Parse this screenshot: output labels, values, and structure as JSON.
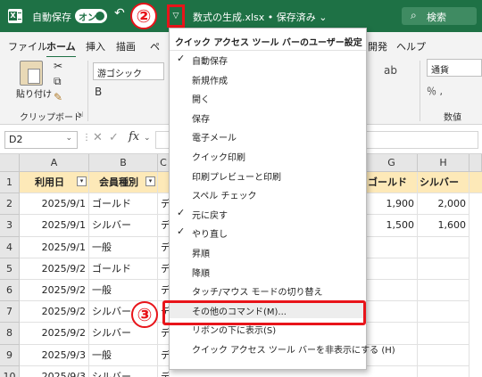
{
  "title_bar": {
    "autosave_label": "自動保存",
    "autosave_state": "オン",
    "step_2": "②",
    "file_title": "数式の生成.xlsx • 保存済み ⌄",
    "search_label": "検索",
    "accent_color": "#1e7145"
  },
  "ribbon": {
    "tabs": [
      "ファイル",
      "ホーム",
      "挿入",
      "描画",
      "ペ",
      "開発",
      "ヘルプ"
    ],
    "paste_label": "貼り付け",
    "clipboard_group": "クリップボード",
    "font_name": "游ゴシック",
    "number_format": "通貨",
    "number_group": "数値"
  },
  "formula_bar": {
    "name_box": "D2",
    "fx": "fx",
    "value": ""
  },
  "grid": {
    "columns": [
      "A",
      "B",
      "C",
      "G",
      "H"
    ],
    "row_numbers": [
      "1",
      "2",
      "3",
      "4",
      "5",
      "6",
      "7",
      "8",
      "9",
      "10"
    ],
    "header": [
      "利用日",
      "会員種別",
      "ゴールド",
      "シルバー"
    ],
    "rows": [
      {
        "date": "2025/9/1",
        "type": "ゴールド",
        "c": "デ",
        "g": "1,900",
        "h": "2,000"
      },
      {
        "date": "2025/9/1",
        "type": "シルバー",
        "c": "デ",
        "g": "1,500",
        "h": "1,600"
      },
      {
        "date": "2025/9/1",
        "type": "一般",
        "c": "デ",
        "g": "",
        "h": ""
      },
      {
        "date": "2025/9/2",
        "type": "ゴールド",
        "c": "デ",
        "g": "",
        "h": ""
      },
      {
        "date": "2025/9/2",
        "type": "一般",
        "c": "デ",
        "g": "",
        "h": ""
      },
      {
        "date": "2025/9/2",
        "type": "シルバー",
        "c": "デ",
        "g": "",
        "h": ""
      },
      {
        "date": "2025/9/2",
        "type": "シルバー",
        "c": "デ",
        "g": "",
        "h": ""
      },
      {
        "date": "2025/9/3",
        "type": "一般",
        "c": "デ",
        "g": "",
        "h": ""
      },
      {
        "date": "2025/9/3",
        "type": "シルバー",
        "c": "デイ",
        "g": "",
        "h": ""
      }
    ],
    "header_fill": "#fde9b8"
  },
  "qat_menu": {
    "title": "クイック アクセス ツール バーのユーザー設定",
    "items": [
      {
        "label": "自動保存",
        "checked": "✓"
      },
      {
        "label": "新規作成",
        "checked": ""
      },
      {
        "label": "開く",
        "checked": ""
      },
      {
        "label": "保存",
        "checked": ""
      },
      {
        "label": "電子メール",
        "checked": ""
      },
      {
        "label": "クイック印刷",
        "checked": ""
      },
      {
        "label": "印刷プレビューと印刷",
        "checked": ""
      },
      {
        "label": "スペル チェック",
        "checked": ""
      },
      {
        "label": "元に戻す",
        "checked": "✓"
      },
      {
        "label": "やり直し",
        "checked": "✓"
      },
      {
        "label": "昇順",
        "checked": ""
      },
      {
        "label": "降順",
        "checked": ""
      },
      {
        "label": "タッチ/マウス モードの切り替え",
        "checked": ""
      },
      {
        "label": "その他のコマンド(M)...",
        "checked": ""
      },
      {
        "label": "リボンの下に表示(S)",
        "checked": ""
      },
      {
        "label": "クイック アクセス ツール バーを非表示にする (H)",
        "checked": ""
      }
    ],
    "step_3": "③",
    "highlight_color": "#e8141a"
  }
}
